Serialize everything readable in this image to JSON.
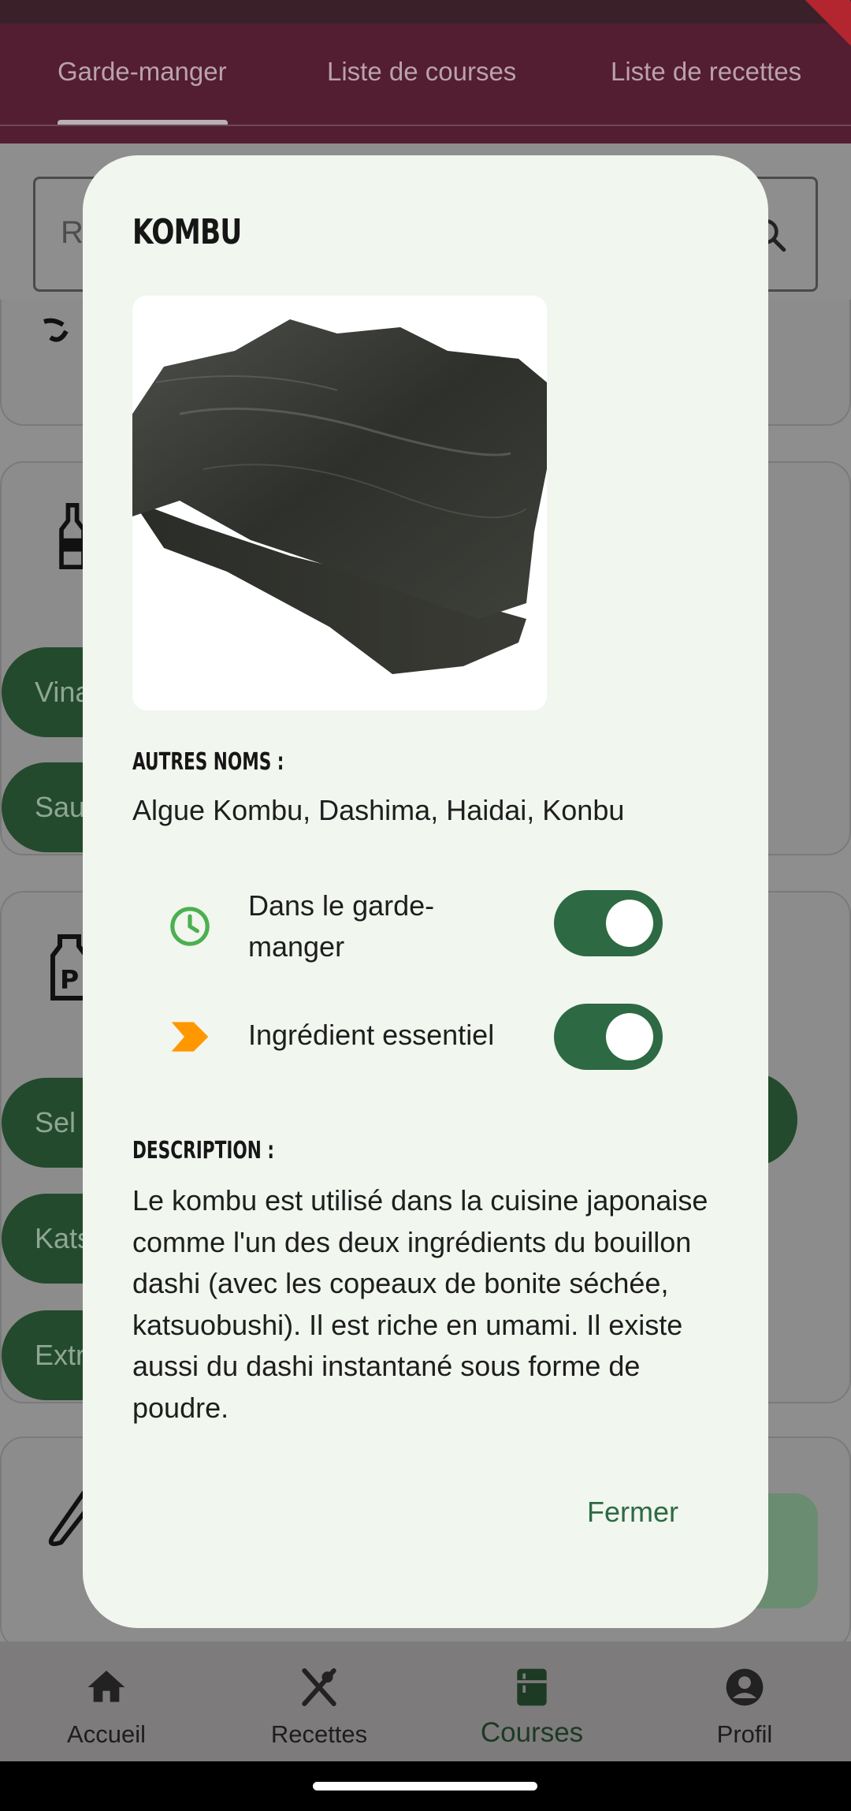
{
  "tabs": [
    {
      "label": "Garde-manger",
      "active": true
    },
    {
      "label": "Liste de courses",
      "active": false
    },
    {
      "label": "Liste de recettes",
      "active": false
    }
  ],
  "search": {
    "placeholder_partial": "Re"
  },
  "background_pills": [
    "Vina",
    "Sau",
    "Sel",
    "Kats",
    "Extr"
  ],
  "dialog": {
    "title": "KOMBU",
    "image_icon": "kombu-seaweed-photo",
    "other_names_label": "AUTRES NOMS :",
    "other_names": "Algue Kombu, Dashima, Haidai, Konbu",
    "toggles": [
      {
        "label": "Dans le garde-manger",
        "icon": "clock-icon",
        "icon_color": "#4caf50",
        "on": true
      },
      {
        "label": "Ingrédient essentiel",
        "icon": "chevron-badge-icon",
        "icon_color": "#ff9800",
        "on": true
      }
    ],
    "description_label": "DESCRIPTION :",
    "description": "Le kombu est utilisé dans la cuisine japonaise comme l'un des deux ingrédients du bouillon dashi (avec les copeaux de bonite séchée, katsuobushi). Il est riche en umami. Il existe aussi du dashi instantané sous forme de poudre.",
    "close_label": "Fermer"
  },
  "bottom_nav": [
    {
      "label": "Accueil",
      "icon": "home-icon",
      "active": false
    },
    {
      "label": "Recettes",
      "icon": "fork-spoon-icon",
      "active": false
    },
    {
      "label": "Courses",
      "icon": "pantry-icon",
      "active": true
    },
    {
      "label": "Profil",
      "icon": "profile-icon",
      "active": false
    }
  ],
  "colors": {
    "accent_green": "#2d6a44",
    "appbar": "#531d32",
    "dialog_bg": "#f1f6ee"
  }
}
